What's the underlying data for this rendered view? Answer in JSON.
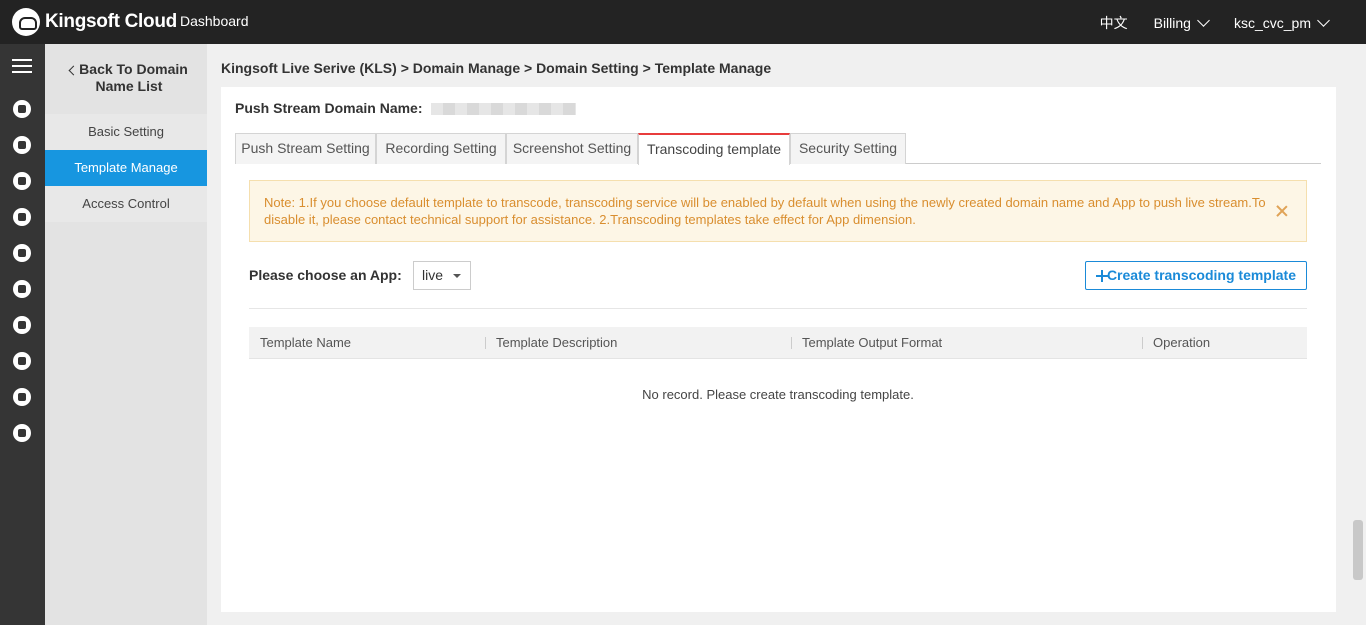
{
  "topbar": {
    "brand": "Kingsoft Cloud",
    "dashboard": "Dashboard",
    "language": "中文",
    "billing": "Billing",
    "user": "ksc_cvc_pm"
  },
  "sidebar": {
    "back_label": "Back To Domain Name List",
    "items": [
      {
        "label": "Basic Setting"
      },
      {
        "label": "Template Manage"
      },
      {
        "label": "Access Control"
      }
    ]
  },
  "breadcrumb": "Kingsoft Live Serive (KLS) > Domain Manage > Domain Setting > Template Manage",
  "domain": {
    "label": "Push Stream Domain Name:"
  },
  "tabs": [
    {
      "label": "Push Stream Setting"
    },
    {
      "label": "Recording Setting"
    },
    {
      "label": "Screenshot Setting"
    },
    {
      "label": "Transcoding template"
    },
    {
      "label": "Security Setting"
    }
  ],
  "notice": "Note: 1.If you choose default template to transcode, transcoding service will be enabled by default when using the newly created domain name and App to push live stream.To disable it, please contact technical support for assistance. 2.Transcoding templates take effect for App dimension.",
  "app": {
    "label": "Please choose an App:",
    "selected": "live"
  },
  "create_button": "Create transcoding template",
  "table": {
    "columns": [
      "Template Name",
      "Template Description",
      "Template Output Format",
      "Operation"
    ],
    "empty_text": "No record. Please create transcoding template."
  },
  "colors": {
    "accent": "#1796e0",
    "active_tab_border": "#e83c3c",
    "notice_text": "#d98e2f"
  }
}
